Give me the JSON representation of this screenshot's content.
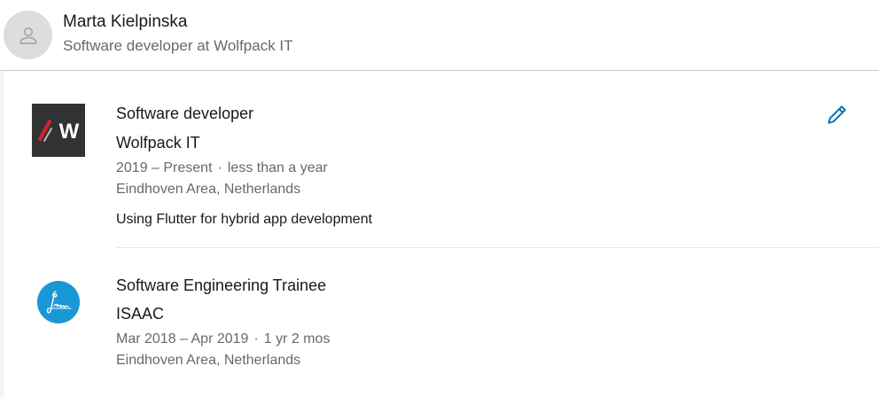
{
  "profile": {
    "name": "Marta Kielpinska",
    "headline": "Software developer at Wolfpack IT",
    "avatar_icon": "person-icon"
  },
  "experience": [
    {
      "title": "Software developer",
      "company": "Wolfpack IT",
      "dates": "2019 – Present",
      "duration": "less than a year",
      "location": "Eindhoven Area, Netherlands",
      "description": "Using Flutter for hybrid app development",
      "logo_icon": "wolfpack-logo-icon",
      "logo_text": "W",
      "edit_icon": "pencil-icon"
    },
    {
      "title": "Software Engineering Trainee",
      "company": "ISAAC",
      "dates": "Mar 2018 – Apr 2019",
      "duration": "1 yr 2 mos",
      "location": "Eindhoven Area, Netherlands",
      "logo_icon": "isaac-logo-icon"
    }
  ],
  "colors": {
    "accent": "#0073b1",
    "isaac_brand": "#1998d5",
    "wolfpack_brand": "#2c2d2f",
    "wolfpack_slash": "#d3232f"
  }
}
